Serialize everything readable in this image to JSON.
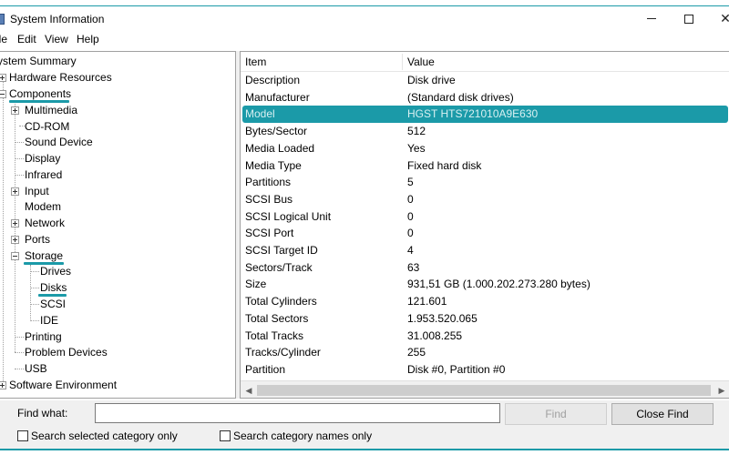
{
  "window": {
    "title": "System Information",
    "controls": [
      "minimize",
      "maximize",
      "close"
    ]
  },
  "menu": {
    "items": [
      "ile",
      "Edit",
      "View",
      "Help"
    ]
  },
  "tree": {
    "items": [
      {
        "label": "ystem Summary"
      },
      {
        "label": "Hardware Resources",
        "expander": "plus"
      },
      {
        "label": "Components",
        "expander": "minus",
        "highlighted": true
      },
      {
        "label": "Multimedia",
        "expander": "plus"
      },
      {
        "label": "CD-ROM"
      },
      {
        "label": "Sound Device"
      },
      {
        "label": "Display"
      },
      {
        "label": "Infrared"
      },
      {
        "label": "Input",
        "expander": "plus"
      },
      {
        "label": "Modem"
      },
      {
        "label": "Network",
        "expander": "plus"
      },
      {
        "label": "Ports",
        "expander": "plus"
      },
      {
        "label": "Storage",
        "expander": "minus",
        "highlighted": true
      },
      {
        "label": "Drives"
      },
      {
        "label": "Disks",
        "highlighted": true
      },
      {
        "label": "SCSI"
      },
      {
        "label": "IDE"
      },
      {
        "label": "Printing"
      },
      {
        "label": "Problem Devices"
      },
      {
        "label": "USB"
      },
      {
        "label": "Software Environment",
        "expander": "plus"
      }
    ]
  },
  "list": {
    "headers": {
      "item": "Item",
      "value": "Value"
    },
    "rows": [
      {
        "item": "Description",
        "value": "Disk drive"
      },
      {
        "item": "Manufacturer",
        "value": "(Standard disk drives)"
      },
      {
        "item": "Model",
        "value": "HGST HTS721010A9E630",
        "selected": true
      },
      {
        "item": "Bytes/Sector",
        "value": "512"
      },
      {
        "item": "Media Loaded",
        "value": "Yes"
      },
      {
        "item": "Media Type",
        "value": "Fixed hard disk"
      },
      {
        "item": "Partitions",
        "value": "5"
      },
      {
        "item": "SCSI Bus",
        "value": "0"
      },
      {
        "item": "SCSI Logical Unit",
        "value": "0"
      },
      {
        "item": "SCSI Port",
        "value": "0"
      },
      {
        "item": "SCSI Target ID",
        "value": "4"
      },
      {
        "item": "Sectors/Track",
        "value": "63"
      },
      {
        "item": "Size",
        "value": "931,51 GB (1.000.202.273.280 bytes)"
      },
      {
        "item": "Total Cylinders",
        "value": "121.601"
      },
      {
        "item": "Total Sectors",
        "value": "1.953.520.065"
      },
      {
        "item": "Total Tracks",
        "value": "31.008.255"
      },
      {
        "item": "Tracks/Cylinder",
        "value": "255"
      },
      {
        "item": "Partition",
        "value": "Disk #0, Partition #0"
      }
    ]
  },
  "find": {
    "label": "Find what:",
    "input_value": "",
    "find_button": "Find",
    "close_button": "Close Find",
    "search_selected_label": "Search selected category only",
    "search_names_label": "Search category names only",
    "search_selected_checked": false,
    "search_names_checked": false
  },
  "colors": {
    "accent": "#1b9aa8",
    "selected_text": "#d8f0f2",
    "pane_border": "#a0a0a0",
    "bar_bg": "#f0f0f0"
  }
}
